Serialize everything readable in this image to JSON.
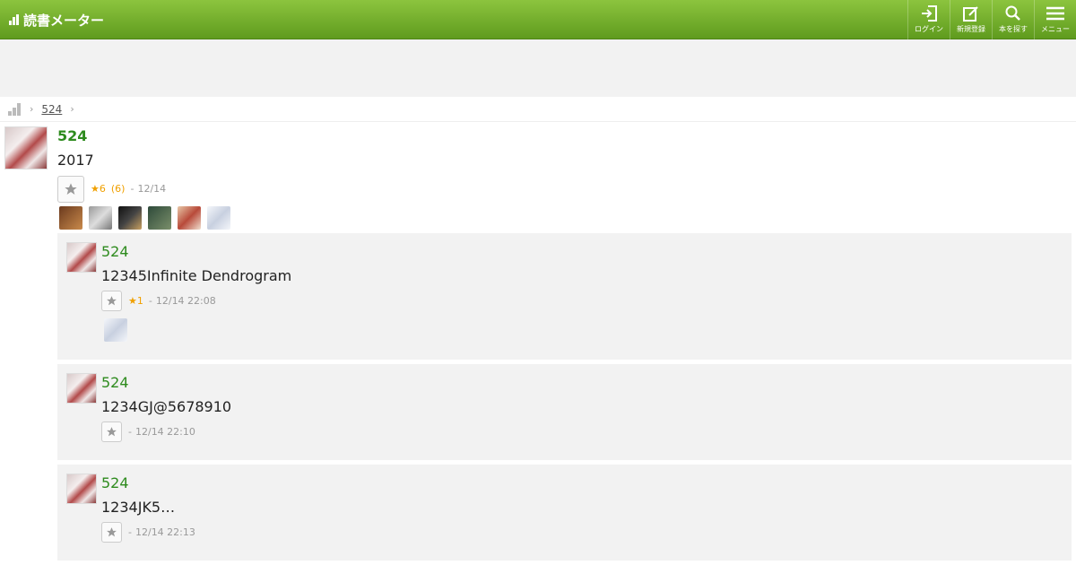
{
  "header": {
    "logo_text": "読書メーター",
    "nav": [
      {
        "label": "ログイン",
        "icon": "login-icon"
      },
      {
        "label": "新規登録",
        "icon": "register-icon"
      },
      {
        "label": "本を探す",
        "icon": "search-icon"
      },
      {
        "label": "メニュー",
        "icon": "menu-icon"
      }
    ]
  },
  "breadcrumb": {
    "link": "524"
  },
  "main_post": {
    "user": "524",
    "text": "2017",
    "likes": "★6",
    "like_count": "(6)",
    "date": "12/14",
    "liker_thumbs": 6
  },
  "replies": [
    {
      "user": "524",
      "text": "12345Infinite Dendrogram",
      "likes": "★1",
      "date": "12/14 22:08",
      "has_thumb": true
    },
    {
      "user": "524",
      "text": "1234GJ@5678910",
      "likes": "",
      "date": "12/14 22:10",
      "has_thumb": false
    },
    {
      "user": "524",
      "text": "1234JK5…",
      "likes": "",
      "date": "12/14 22:13",
      "has_thumb": false
    }
  ],
  "colors": {
    "brand_green": "#5f9b1e",
    "link_green": "#2e8b1e",
    "star_orange": "#f0a000"
  }
}
